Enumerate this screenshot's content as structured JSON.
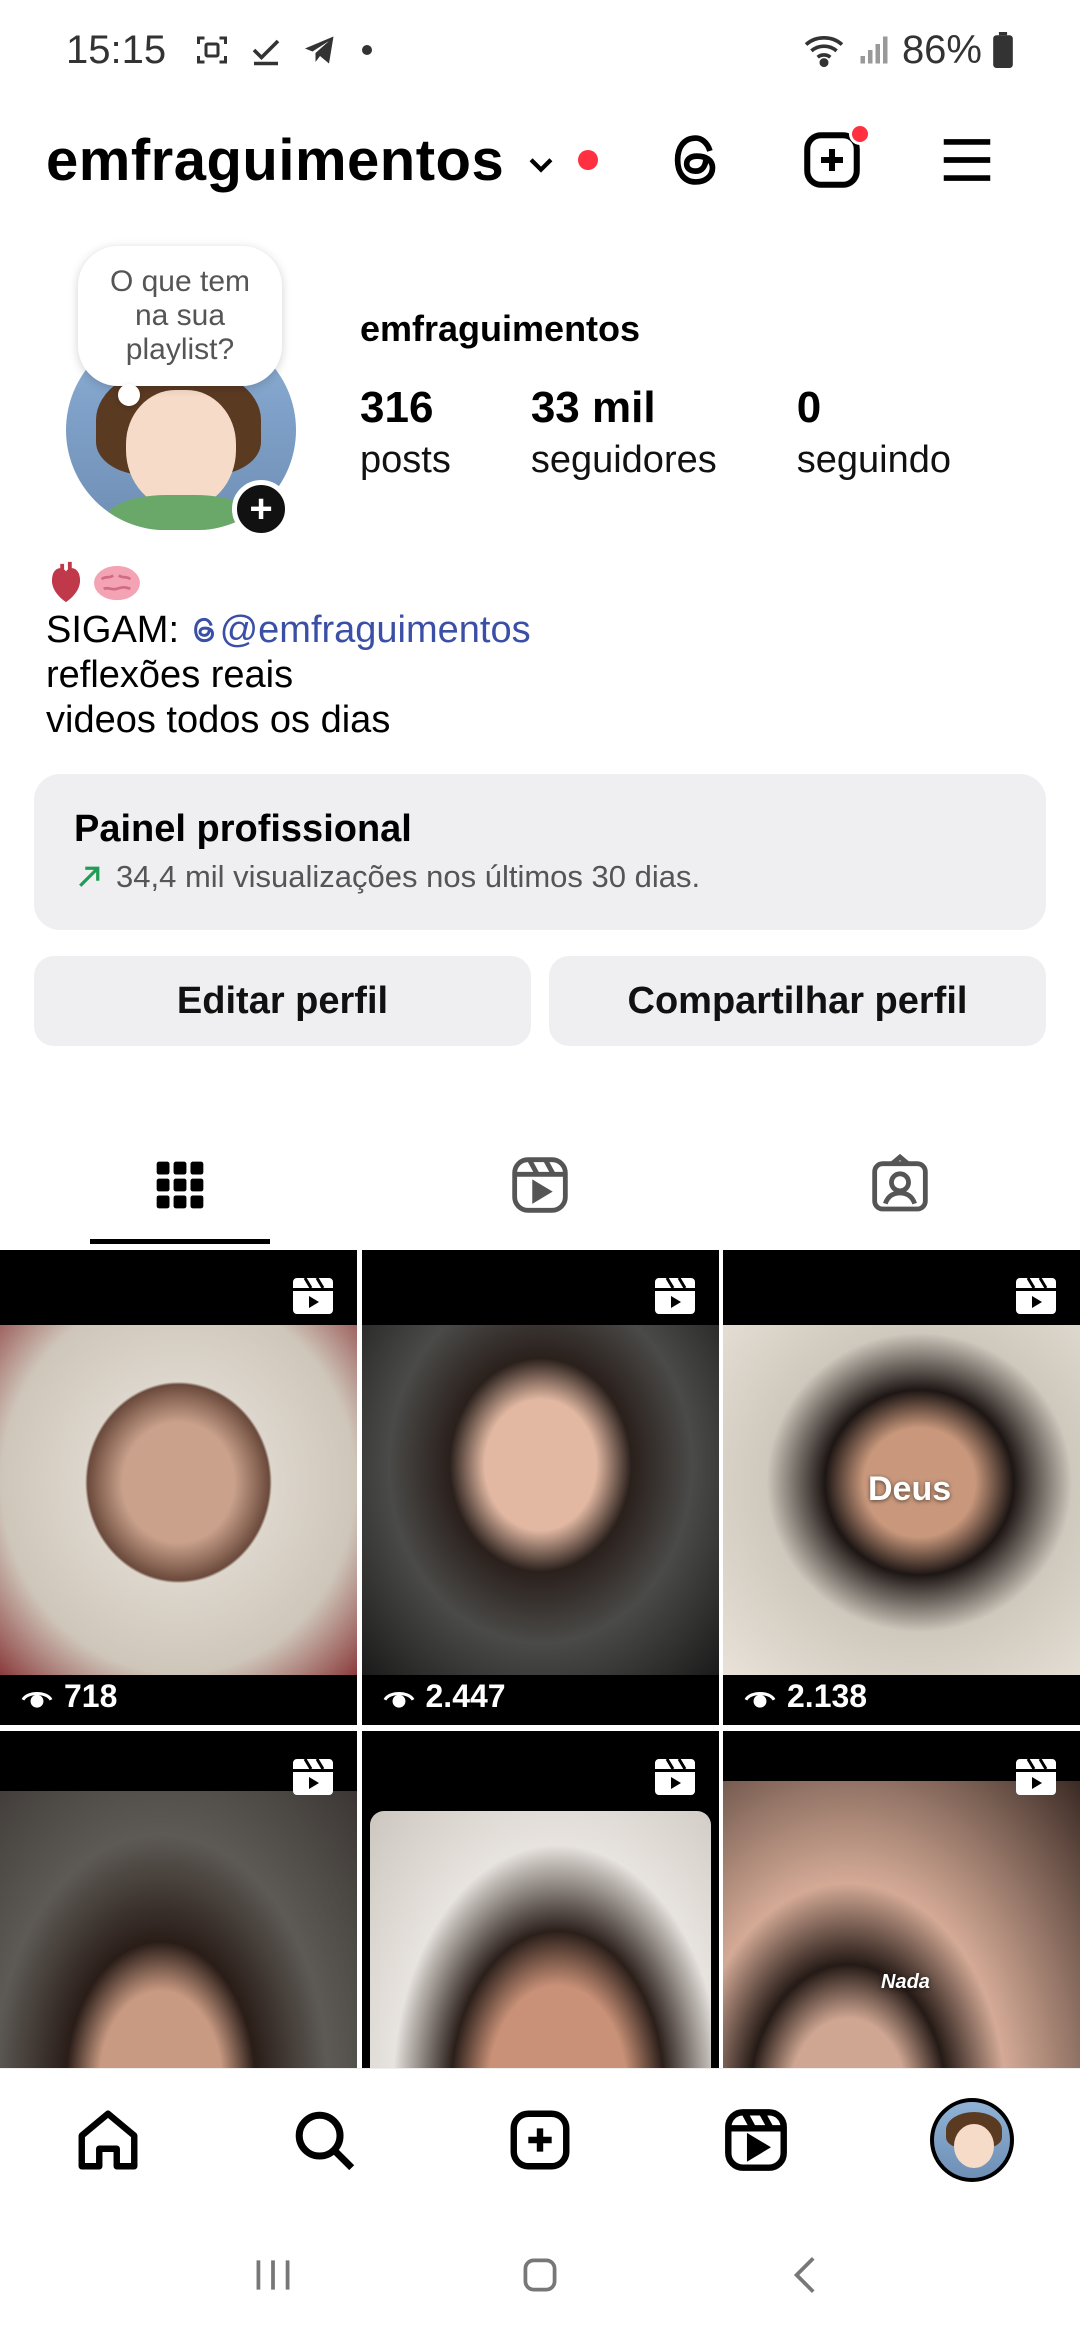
{
  "status_bar": {
    "time": "15:15",
    "battery": "86%"
  },
  "header": {
    "username": "emfraguimentos"
  },
  "note": {
    "text": "O que tem na sua playlist?"
  },
  "profile": {
    "name": "emfraguimentos",
    "stats": [
      {
        "value": "316",
        "label": "posts"
      },
      {
        "value": "33 mil",
        "label": "seguidores"
      },
      {
        "value": "0",
        "label": "seguindo"
      }
    ],
    "bio": {
      "prefix": "SIGAM: ",
      "mention": "@emfraguimentos",
      "line2": "reflexões reais",
      "line3": "videos todos os dias"
    }
  },
  "panel": {
    "title": "Painel profissional",
    "subtitle": "34,4 mil visualizações nos últimos 30 dias."
  },
  "buttons": {
    "edit": "Editar perfil",
    "share": "Compartilhar perfil"
  },
  "grid": {
    "items": [
      {
        "views": "718",
        "caption": ""
      },
      {
        "views": "2.447",
        "caption": ""
      },
      {
        "views": "2.138",
        "caption": "Deus"
      },
      {
        "views": "",
        "caption": ""
      },
      {
        "views": "",
        "caption": ""
      },
      {
        "views": "",
        "caption": "Nada"
      }
    ]
  },
  "icons": {
    "threads": "threads-icon",
    "create": "plus-square-icon",
    "menu": "hamburger-menu-icon",
    "grid": "grid-icon",
    "reels": "reels-icon",
    "tagged": "tagged-person-icon",
    "home": "home-icon",
    "search": "search-icon",
    "new_post": "plus-square-icon"
  },
  "colors": {
    "notification_dot": "#ff3040",
    "mention": "#3b4fa6",
    "panel_bg": "#efeff2",
    "trend_arrow": "#1f9d55"
  }
}
